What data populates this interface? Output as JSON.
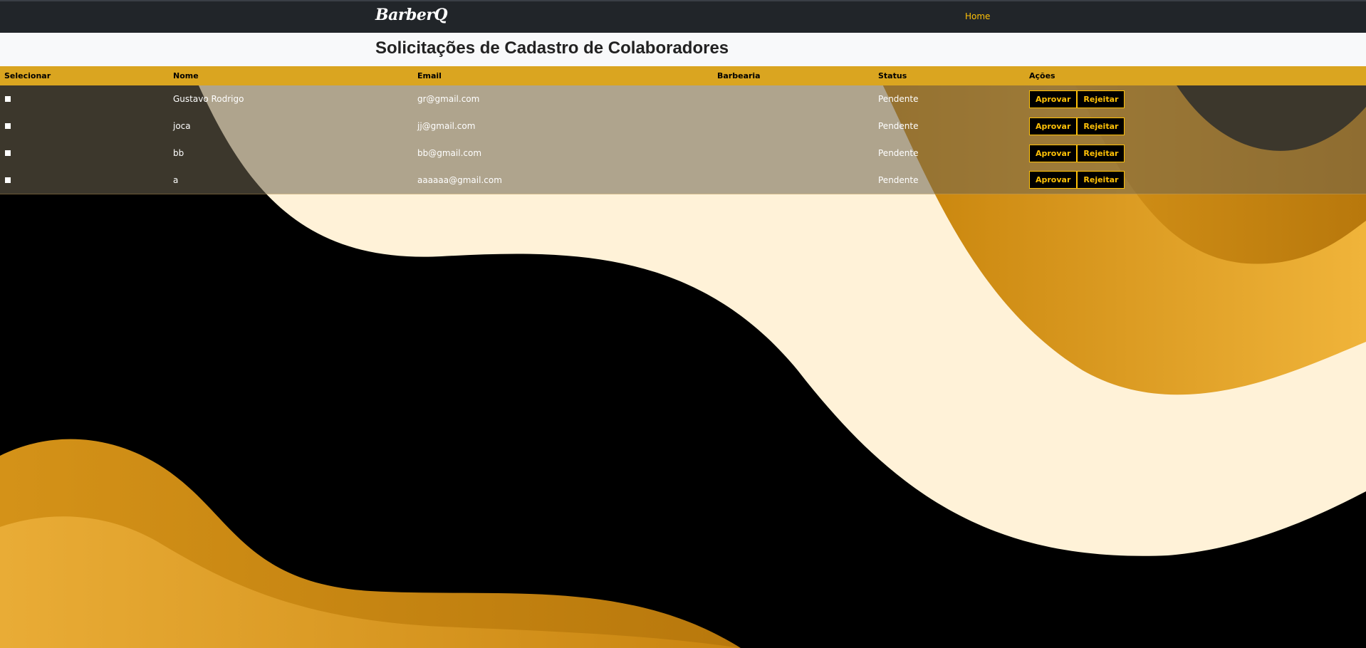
{
  "navbar": {
    "brand": "BarberQ",
    "home_link": "Home"
  },
  "page": {
    "title": "Solicitações de Cadastro de Colaboradores"
  },
  "table": {
    "headers": [
      "Selecionar",
      "Nome",
      "Email",
      "Barbearia",
      "Status",
      "Ações"
    ],
    "rows": [
      {
        "nome": "Gustavo Rodrigo",
        "email": "gr@gmail.com",
        "barbearia": "",
        "status": "Pendente"
      },
      {
        "nome": "joca",
        "email": "jj@gmail.com",
        "barbearia": "",
        "status": "Pendente"
      },
      {
        "nome": "bb",
        "email": "bb@gmail.com",
        "barbearia": "",
        "status": "Pendente"
      },
      {
        "nome": "a",
        "email": "aaaaaa@gmail.com",
        "barbearia": "",
        "status": "Pendente"
      }
    ],
    "approve_label": "Aprovar",
    "reject_label": "Rejeitar"
  },
  "colors": {
    "navbar_bg": "#212529",
    "accent": "#ffc107",
    "header_bg": "#daa520",
    "cream": "#fff2d8",
    "gold": "#e0a02a"
  }
}
